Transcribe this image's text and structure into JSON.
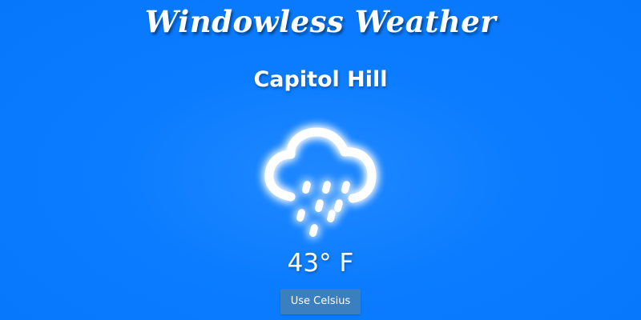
{
  "app": {
    "title": "Windowless Weather"
  },
  "location": {
    "name": "Capitol Hill"
  },
  "weather": {
    "icon": "cloud-rain-icon",
    "temperature": "43° F"
  },
  "controls": {
    "unit_toggle_label": "Use Celsius"
  },
  "colors": {
    "background": "#0b7cff",
    "button": "#3a7fc0",
    "text": "#ffffff"
  }
}
